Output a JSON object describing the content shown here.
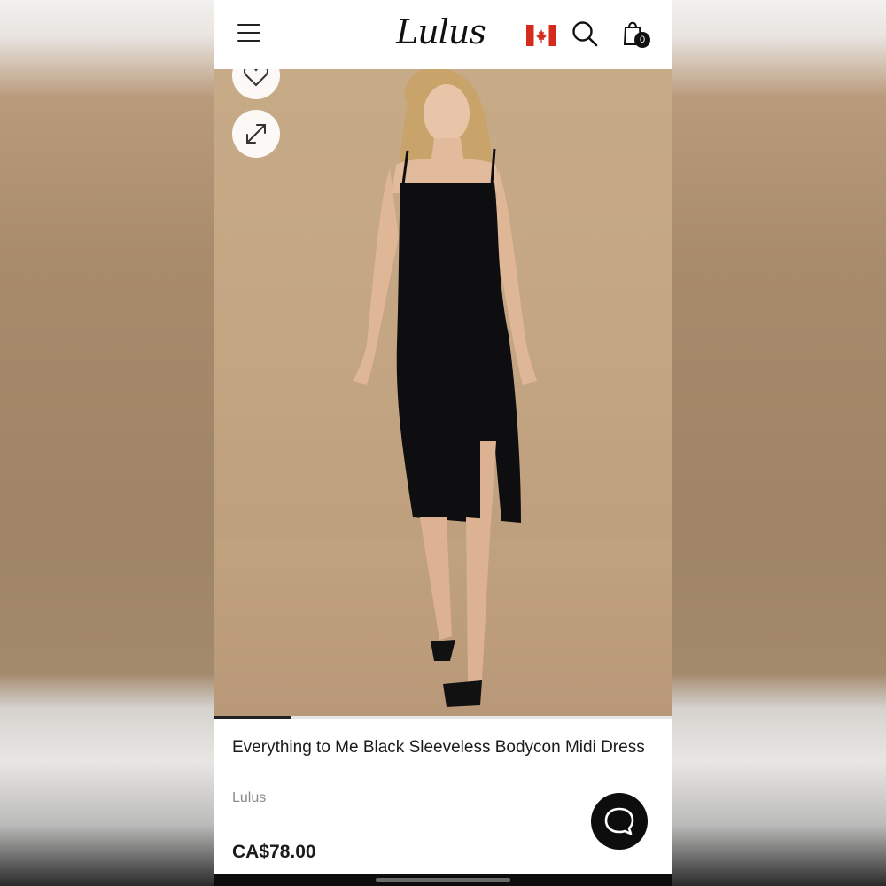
{
  "header": {
    "logo_text": "Lulus",
    "menu_icon": "hamburger-menu-icon",
    "flag_icon": "canada-flag-icon",
    "search_icon": "search-icon",
    "bag_icon": "shopping-bag-icon",
    "bag_count": "0"
  },
  "gallery": {
    "wishlist_icon": "heart-icon",
    "fullscreen_icon": "expand-icon",
    "progress_fraction": 0.166
  },
  "product": {
    "title": "Everything to Me Black Sleeveless Bodycon Midi Dress",
    "brand": "Lulus",
    "price": "CA$78.00"
  },
  "chat": {
    "icon": "chat-bubble-icon"
  },
  "colors": {
    "accent": "#111111",
    "hero_background": "#c4a683",
    "flag_red": "#d52b1e"
  }
}
